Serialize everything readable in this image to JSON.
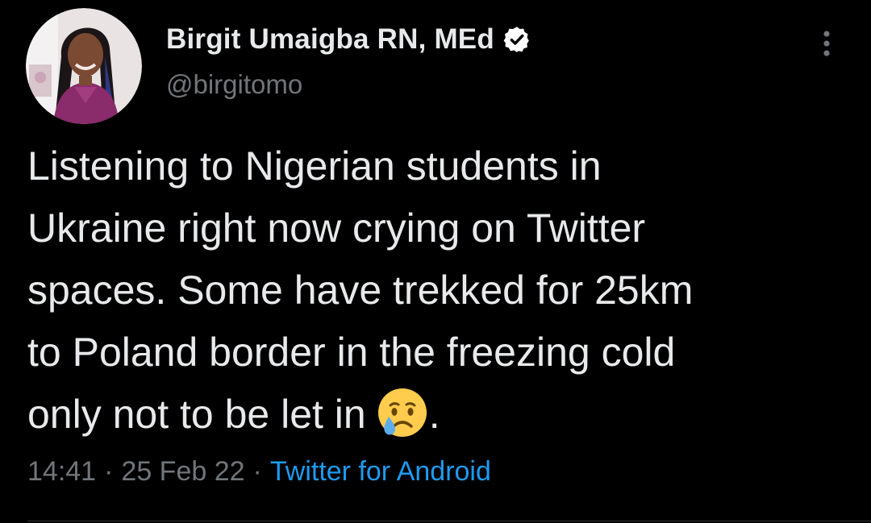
{
  "author": {
    "display_name": "Birgit Umaigba RN, MEd",
    "handle": "@birgitomo",
    "verified": true,
    "avatar": "profile-photo"
  },
  "tweet": {
    "text_lines": [
      "Listening to Nigerian students in",
      "Ukraine right now crying on Twitter",
      "spaces. Some have trekked for 25km",
      "to Poland border in the freezing cold",
      "only not to be let in"
    ],
    "emoji": "crying-face-emoji",
    "end_punct": "."
  },
  "meta": {
    "time": "14:41",
    "separator": "·",
    "date": "25 Feb 22",
    "source": "Twitter for Android"
  },
  "icons": {
    "more": "more-vertical-icon",
    "verified": "verified-badge-icon"
  },
  "colors": {
    "background": "#000000",
    "text_primary": "#e7e9ea",
    "text_secondary": "#71767b",
    "link": "#1d9bf0",
    "verified_badge": "#ffffff"
  }
}
